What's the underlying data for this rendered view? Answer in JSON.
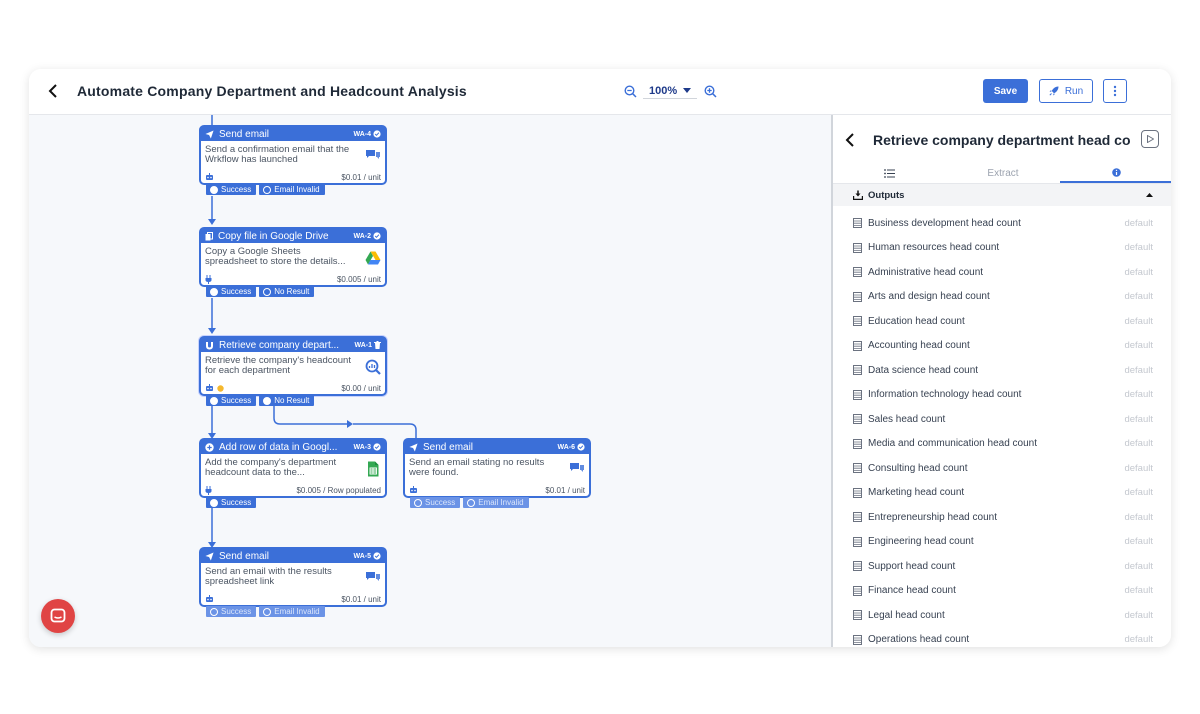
{
  "header": {
    "title": "Automate Company Department and Headcount Analysis",
    "zoom": "100%",
    "save_label": "Save",
    "run_label": "Run"
  },
  "nodes": [
    {
      "key": "n1",
      "title": "Send email",
      "id": "WA-4",
      "desc": "Send a confirmation email that the Wrkflow has launched",
      "cost": "$0.01 / unit",
      "icon": "chat-bubbles-icon",
      "pills": [
        "Success",
        "Email Invalid"
      ]
    },
    {
      "key": "n2",
      "title": "Copy file in Google Drive",
      "id": "WA-2",
      "desc": "Copy a Google Sheets spreadsheet to store the details...",
      "cost": "$0.005 / unit",
      "icon": "google-drive-icon",
      "pills": [
        "Success",
        "No Result"
      ]
    },
    {
      "key": "n3",
      "title": "Retrieve company depart...",
      "id": "WA-1",
      "desc": "Retrieve the company's headcount for each department",
      "cost": "$0.00 / unit",
      "icon": "magnifier-chart-icon",
      "pills": [
        "Success",
        "No Result"
      ]
    },
    {
      "key": "n4",
      "title": "Add row of data in Googl...",
      "id": "WA-3",
      "desc": "Add the company's department headcount data to the...",
      "cost": "$0.005 / Row populated",
      "icon": "google-sheets-icon",
      "pills": [
        "Success"
      ]
    },
    {
      "key": "n5",
      "title": "Send email",
      "id": "WA-6",
      "desc": "Send an email stating no results were found.",
      "cost": "$0.01 / unit",
      "icon": "chat-bubbles-icon",
      "pills": [
        "Success",
        "Email Invalid"
      ]
    },
    {
      "key": "n6",
      "title": "Send email",
      "id": "WA-5",
      "desc": "Send an email with the results spreadsheet link",
      "cost": "$0.01 / unit",
      "icon": "chat-bubbles-icon",
      "pills": [
        "Success",
        "Email Invalid"
      ]
    }
  ],
  "panel": {
    "title": "Retrieve company department head count",
    "tab_extract": "Extract",
    "outputs_label": "Outputs",
    "default_label": "default",
    "outputs": [
      "Business development head count",
      "Human resources head count",
      "Administrative head count",
      "Arts and design head count",
      "Education head count",
      "Accounting head count",
      "Data science head count",
      "Information technology head count",
      "Sales head count",
      "Media and communication head count",
      "Consulting head count",
      "Marketing head count",
      "Entrepreneurship head count",
      "Engineering head count",
      "Support head count",
      "Finance head count",
      "Legal head count",
      "Operations head count"
    ]
  },
  "colors": {
    "accent": "#3b6fd8",
    "chat": "#e04444"
  }
}
